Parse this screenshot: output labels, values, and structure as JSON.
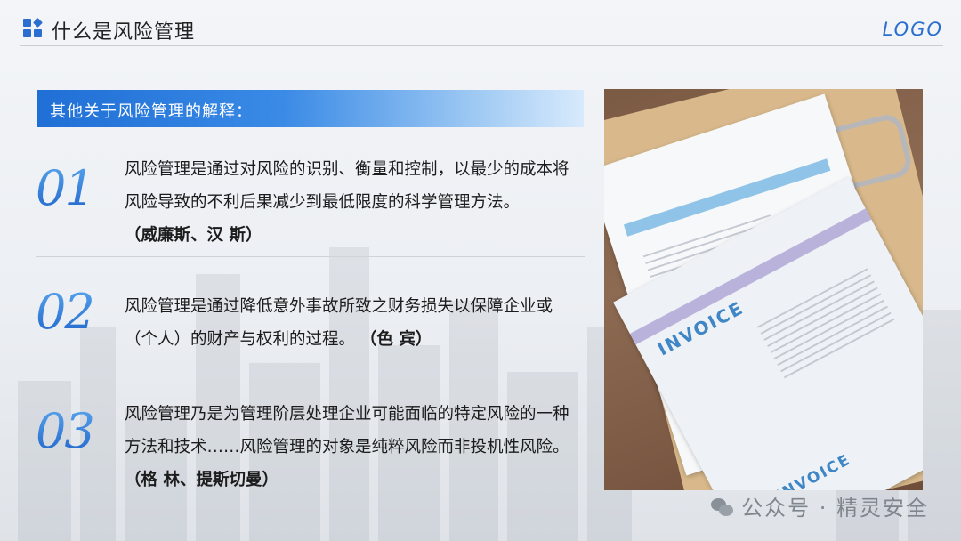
{
  "header": {
    "title": "什么是风险管理",
    "logo": "LOGO"
  },
  "banner": {
    "text": "其他关于风险管理的解释："
  },
  "items": [
    {
      "number": "01",
      "text": "风险管理是通过对风险的识别、衡量和控制，以最少的成本将风险导致的不利后果减少到最低限度的科学管理方法。",
      "source": "（威廉斯、汉 斯）"
    },
    {
      "number": "02",
      "text": "风险管理是通过降低意外事故所致之财务损失以保障企业或（个人）的财产与权利的过程。",
      "source": "（色 宾）"
    },
    {
      "number": "03",
      "text": "风险管理乃是为管理阶层处理企业可能面临的特定风险的一种方法和技术……风险管理的对象是纯粹风险而非投机性风险。",
      "source": "（格 林、提斯切曼）"
    }
  ],
  "photo": {
    "invoice_label": "INVOICE",
    "invoice_label_2": "INVOICE"
  },
  "watermark": {
    "text": "公众号 · 精灵安全"
  },
  "colors": {
    "accent": "#2a6fd0",
    "banner_start": "#1f6fd6",
    "number": "#2d7de0"
  }
}
